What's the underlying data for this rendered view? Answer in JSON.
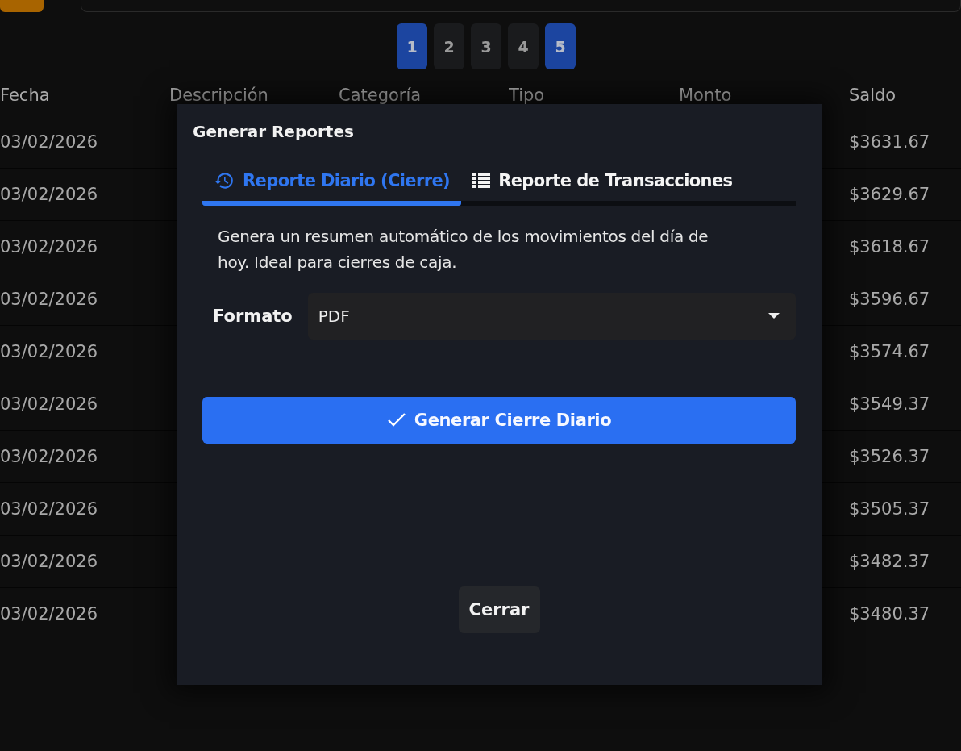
{
  "pagination": [
    {
      "label": "1",
      "selected": true
    },
    {
      "label": "2",
      "selected": false
    },
    {
      "label": "3",
      "selected": false
    },
    {
      "label": "4",
      "selected": false
    },
    {
      "label": "5",
      "selected": true
    }
  ],
  "table": {
    "columns": [
      "Fecha",
      "Descripción",
      "Categoría",
      "Tipo",
      "Monto",
      "Saldo"
    ],
    "rows": [
      {
        "fecha": "03/02/2026",
        "saldo": "$3631.67"
      },
      {
        "fecha": "03/02/2026",
        "saldo": "$3629.67"
      },
      {
        "fecha": "03/02/2026",
        "saldo": "$3618.67"
      },
      {
        "fecha": "03/02/2026",
        "saldo": "$3596.67"
      },
      {
        "fecha": "03/02/2026",
        "saldo": "$3574.67"
      },
      {
        "fecha": "03/02/2026",
        "saldo": "$3549.37"
      },
      {
        "fecha": "03/02/2026",
        "saldo": "$3526.37"
      },
      {
        "fecha": "03/02/2026",
        "saldo": "$3505.37"
      },
      {
        "fecha": "03/02/2026",
        "saldo": "$3482.37"
      },
      {
        "fecha": "03/02/2026",
        "saldo": "$3480.37"
      }
    ]
  },
  "dialog": {
    "title": "Generar Reportes",
    "tabs": [
      {
        "label": "Reporte Diario (Cierre)",
        "kind": "history",
        "selected": true
      },
      {
        "label": "Reporte de Transacciones",
        "kind": "list",
        "selected": false
      }
    ],
    "description": "Genera un resumen automático de los movimientos del día de hoy. Ideal para cierres de caja.",
    "format": {
      "label": "Formato",
      "value": "PDF"
    },
    "generate_button": "Generar Cierre Diario",
    "close_button": "Cerrar"
  }
}
